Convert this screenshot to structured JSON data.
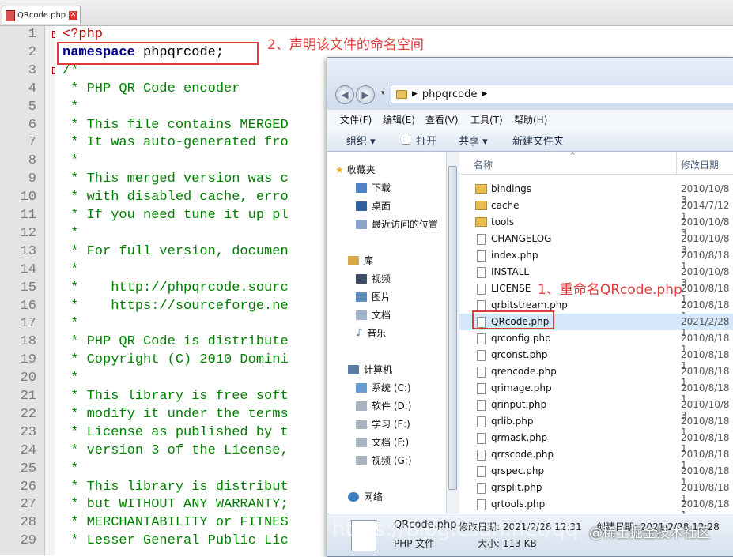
{
  "editor": {
    "tab_label": "QRcode.php",
    "line_numbers": [
      "1",
      "2",
      "3",
      "4",
      "5",
      "6",
      "7",
      "8",
      "9",
      "10",
      "11",
      "12",
      "13",
      "14",
      "15",
      "16",
      "17",
      "18",
      "19",
      "20",
      "21",
      "22",
      "23",
      "24",
      "25",
      "26",
      "27",
      "28",
      "29"
    ],
    "lines": [
      "<?php",
      "namespace phpqrcode;",
      "/*",
      " * PHP QR Code encoder",
      " *",
      " * This file contains MERGED",
      " * It was auto-generated fro",
      " *",
      " * This merged version was c",
      " * with disabled cache, erro",
      " * If you need tune it up pl",
      " *",
      " * For full version, documen",
      " *",
      " *    http://phpqrcode.sourc",
      " *    https://sourceforge.ne",
      " *",
      " * PHP QR Code is distribute",
      " * Copyright (C) 2010 Domini",
      " *",
      " * This library is free soft",
      " * modify it under the terms",
      " * License as published by t",
      " * version 3 of the License,",
      " *",
      " * This library is distribut",
      " * but WITHOUT ANY WARRANTY;",
      " * MERCHANTABILITY or FITNES",
      " * Lesser General Public Lic"
    ],
    "line2_keyword": "namespace",
    "line2_rest": " phpqrcode;",
    "annotation_2": "2、声明该文件的命名空间"
  },
  "explorer": {
    "address": "phpqrcode",
    "menus": [
      "文件(F)",
      "编辑(E)",
      "查看(V)",
      "工具(T)",
      "帮助(H)"
    ],
    "commands": [
      "组织 ▾",
      "打开",
      "共享 ▾",
      "新建文件夹"
    ],
    "nav": {
      "favorites": "收藏夹",
      "favorite_items": [
        "下载",
        "桌面",
        "最近访问的位置"
      ],
      "library": "库",
      "library_items": [
        "视频",
        "图片",
        "文档",
        "音乐"
      ],
      "computer": "计算机",
      "drives": [
        "系统 (C:)",
        "软件 (D:)",
        "学习 (E:)",
        "文档 (F:)",
        "视频 (G:)"
      ],
      "network": "网络"
    },
    "columns": {
      "name": "名称",
      "date": "修改日期"
    },
    "files": [
      {
        "name": "bindings",
        "date": "2010/10/8 3",
        "folder": true
      },
      {
        "name": "cache",
        "date": "2014/7/12 1",
        "folder": true
      },
      {
        "name": "tools",
        "date": "2010/10/8 3",
        "folder": true
      },
      {
        "name": "CHANGELOG",
        "date": "2010/10/8 3",
        "folder": false
      },
      {
        "name": "index.php",
        "date": "2010/8/18 1",
        "folder": false
      },
      {
        "name": "INSTALL",
        "date": "2010/10/8 3",
        "folder": false
      },
      {
        "name": "LICENSE",
        "date": "2010/8/18 1",
        "folder": false
      },
      {
        "name": "qrbitstream.php",
        "date": "2010/8/18 1",
        "folder": false
      },
      {
        "name": "QRcode.php",
        "date": "2021/2/28 1",
        "folder": false,
        "selected": true
      },
      {
        "name": "qrconfig.php",
        "date": "2010/8/18 1",
        "folder": false
      },
      {
        "name": "qrconst.php",
        "date": "2010/8/18 1",
        "folder": false
      },
      {
        "name": "qrencode.php",
        "date": "2010/8/18 1",
        "folder": false
      },
      {
        "name": "qrimage.php",
        "date": "2010/8/18 1",
        "folder": false
      },
      {
        "name": "qrinput.php",
        "date": "2010/10/8 3",
        "folder": false
      },
      {
        "name": "qrlib.php",
        "date": "2010/8/18 1",
        "folder": false
      },
      {
        "name": "qrmask.php",
        "date": "2010/8/18 1",
        "folder": false
      },
      {
        "name": "qrrscode.php",
        "date": "2010/8/18 1",
        "folder": false
      },
      {
        "name": "qrspec.php",
        "date": "2010/8/18 1",
        "folder": false
      },
      {
        "name": "qrsplit.php",
        "date": "2010/8/18 1",
        "folder": false
      },
      {
        "name": "qrtools.php",
        "date": "2010/8/18 1",
        "folder": false
      }
    ],
    "annotation_1": "1、重命名QRcode.php",
    "details": {
      "filename": "QRcode.php",
      "modified": "修改日期: 2021/2/28 12:31",
      "type": "PHP 文件",
      "size": "大小: 113 KB",
      "created": "创建日期: 2021/2/28 12:28"
    }
  },
  "watermark": "@稀土掘金技术社区",
  "url_watermark": "https://blog.csdn.net/qq"
}
